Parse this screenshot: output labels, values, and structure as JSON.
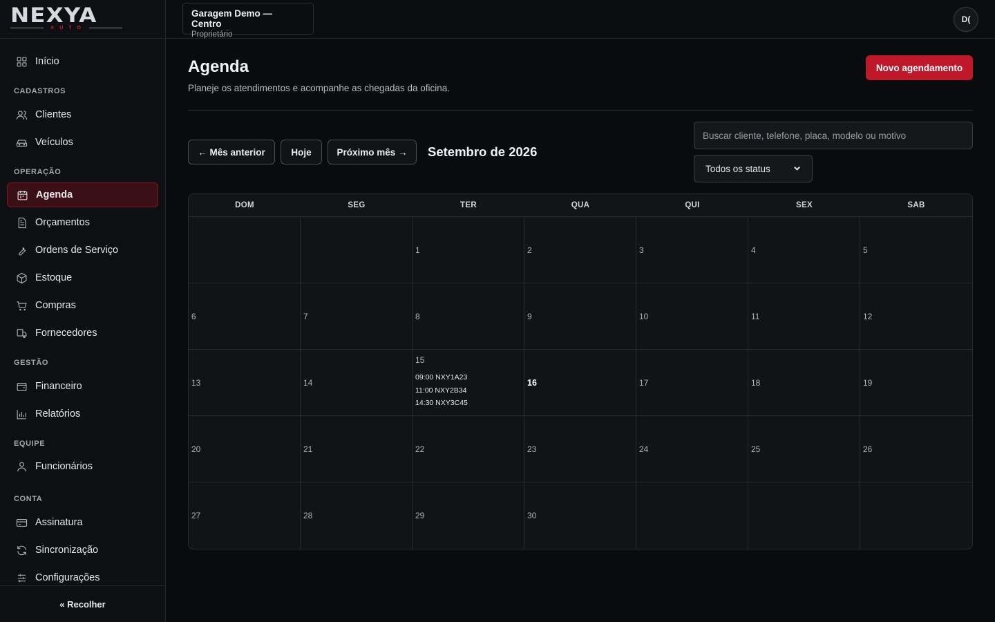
{
  "brand": {
    "logo_text": "NEXYA",
    "logo_sub": "AUTO",
    "accent": "#c0182b"
  },
  "sidebar": {
    "home": "Início",
    "sections": [
      {
        "title": "CADASTROS",
        "items": [
          "Clientes",
          "Veículos"
        ]
      },
      {
        "title": "OPERAÇÃO",
        "items": [
          "Agenda",
          "Orçamentos",
          "Ordens de Serviço",
          "Estoque",
          "Compras",
          "Fornecedores"
        ]
      },
      {
        "title": "GESTÃO",
        "items": [
          "Financeiro",
          "Relatórios"
        ]
      },
      {
        "title": "EQUIPE",
        "items": [
          "Funcionários"
        ]
      },
      {
        "title": "CONTA",
        "items": [
          "Assinatura",
          "Sincronização",
          "Configurações"
        ]
      }
    ],
    "active_item": "Agenda",
    "collapse_label": "« Recolher"
  },
  "topbar": {
    "workspace_name": "Garagem Demo — Centro",
    "workspace_role": "Proprietário",
    "avatar_initials": "D("
  },
  "page": {
    "title": "Agenda",
    "subtitle": "Planeje os atendimentos e acompanhe as chegadas da oficina.",
    "new_button": "Novo agendamento"
  },
  "controls": {
    "prev_month": "← Mês anterior",
    "today": "Hoje",
    "next_month": "Próximo mês →",
    "month_label": "Setembro de 2026",
    "search_placeholder": "Buscar cliente, telefone, placa, modelo ou motivo",
    "status_filter": "Todos os status"
  },
  "calendar": {
    "weekdays": [
      "DOM",
      "SEG",
      "TER",
      "QUA",
      "QUI",
      "SEX",
      "SAB"
    ],
    "weeks": [
      [
        "",
        "",
        "1",
        "2",
        "3",
        "4",
        "5"
      ],
      [
        "6",
        "7",
        "8",
        "9",
        "10",
        "11",
        "12"
      ],
      [
        "13",
        "14",
        "15",
        "16",
        "17",
        "18",
        "19"
      ],
      [
        "20",
        "21",
        "22",
        "23",
        "24",
        "25",
        "26"
      ],
      [
        "27",
        "28",
        "29",
        "30",
        "",
        "",
        ""
      ]
    ],
    "today": "16",
    "events": {
      "15": [
        "09:00 NXY1A23",
        "11:00 NXY2B34",
        "14:30 NXY3C45"
      ]
    }
  }
}
